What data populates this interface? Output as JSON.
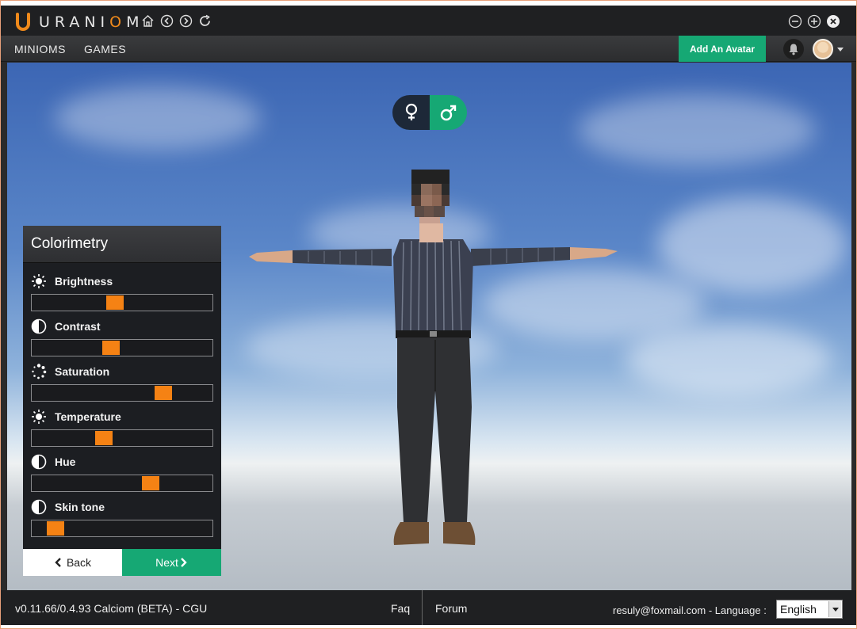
{
  "app": {
    "brand_pre": "URANI",
    "brand_o": "O",
    "brand_post": "M"
  },
  "colors": {
    "accent_green": "#16a874",
    "slider_thumb": "#f58214",
    "logo_orange": "#f08a1b",
    "panel_bg": "#1c1e22"
  },
  "titlebar": {
    "nav_icons": [
      "home-icon",
      "back-arrow-icon",
      "forward-arrow-icon",
      "refresh-icon"
    ],
    "window_controls": [
      "minimize-icon",
      "maximize-icon",
      "close-icon"
    ]
  },
  "menu": {
    "items": [
      {
        "label": "MINIOMS"
      },
      {
        "label": "GAMES"
      }
    ],
    "add_avatar_label": "Add An Avatar"
  },
  "gender": {
    "female_icon": "female-symbol-icon",
    "male_icon": "male-symbol-icon",
    "selected": "male"
  },
  "colorimetry": {
    "title": "Colorimetry",
    "sliders": [
      {
        "label": "Brightness",
        "icon": "sun-icon",
        "value": 0.46
      },
      {
        "label": "Contrast",
        "icon": "contrast-icon",
        "value": 0.44
      },
      {
        "label": "Saturation",
        "icon": "saturation-dots-icon",
        "value": 0.73
      },
      {
        "label": "Temperature",
        "icon": "sun-icon",
        "value": 0.4
      },
      {
        "label": "Hue",
        "icon": "contrast-icon",
        "value": 0.66
      },
      {
        "label": "Skin tone",
        "icon": "contrast-icon",
        "value": 0.13
      }
    ],
    "back_label": "Back",
    "next_label": "Next"
  },
  "status": {
    "version": "v0.11.66/0.4.93 Calciom (BETA) - CGU",
    "faq": "Faq",
    "forum": "Forum",
    "email_language": "resuly@foxmail.com - Language :",
    "language": "English"
  }
}
